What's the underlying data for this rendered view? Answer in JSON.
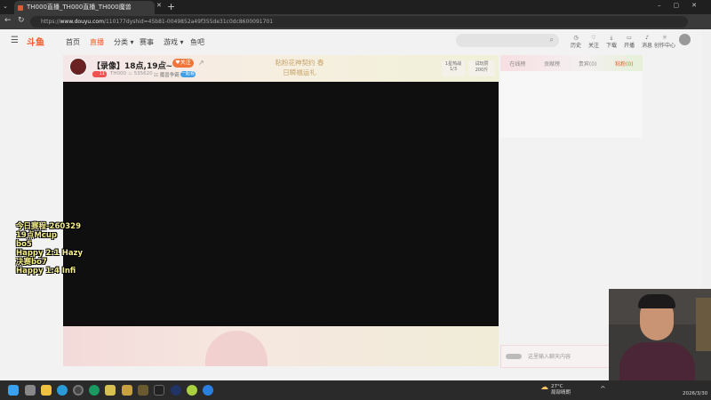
{
  "browser": {
    "tab_title": "TH000直播_TH000直播_TH000魔兽",
    "url_prefix": "https://",
    "url_host": "www.douyu.com",
    "url_path": "/110177dyshid=45b81-0049852a49f355de31c0dc8600091701"
  },
  "header": {
    "logo": "斗鱼",
    "nav": [
      "首页",
      "直播",
      "分类 ▾",
      "赛事",
      "游戏 ▾",
      "鱼吧"
    ],
    "icons": [
      {
        "name": "history",
        "label": "历史"
      },
      {
        "name": "follow",
        "label": "关注"
      },
      {
        "name": "download",
        "label": "下载"
      },
      {
        "name": "broadcast",
        "label": "开播"
      },
      {
        "name": "message",
        "label": "消息"
      },
      {
        "name": "creator",
        "label": "创作中心"
      }
    ]
  },
  "room": {
    "title": "【录像】18点,19点~",
    "follow_label": "关注",
    "level": "11",
    "streamer": "TH000",
    "hot": "535620",
    "category": "魔兽争霸",
    "badge": "一起看",
    "promo": "粘粉花神契约 春日瞬福运礼",
    "rank_label": "1星热战",
    "rank_value": "1/3",
    "gift_label": "试玩赞",
    "gift_value": "200斤"
  },
  "overlay_lines": [
    "今日赛程-260329",
    "19点Mcup",
    "bo5",
    "Happy 2:1 Hazy",
    "决赛bo7",
    "Happy 1:4 Infi"
  ],
  "panel": {
    "tabs": [
      "在线榜",
      "贡献榜",
      "贵宾(0)",
      "粘粉(0)"
    ],
    "chat_placeholder": "这里输入聊天内容"
  },
  "taskbar": {
    "weather_temp": "27°C",
    "weather_desc": "局部晴朗",
    "date": "2026/3/30"
  }
}
